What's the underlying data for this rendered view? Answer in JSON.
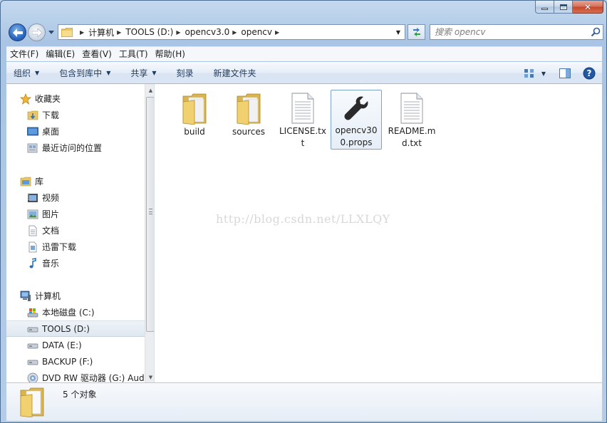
{
  "window": {
    "close_glyph": "✕"
  },
  "address": {
    "crumbs": [
      "计算机",
      "TOOLS (D:)",
      "opencv3.0",
      "opencv"
    ]
  },
  "search": {
    "placeholder": "搜索 opencv"
  },
  "menu": {
    "items": [
      "文件(F)",
      "编辑(E)",
      "查看(V)",
      "工具(T)",
      "帮助(H)"
    ]
  },
  "toolbar": {
    "organize": "组织",
    "include_library": "包含到库中",
    "share": "共享",
    "burn": "刻录",
    "new_folder": "新建文件夹"
  },
  "nav": {
    "favorites": {
      "label": "收藏夹",
      "items": [
        "下载",
        "桌面",
        "最近访问的位置"
      ]
    },
    "libraries": {
      "label": "库",
      "items": [
        "视频",
        "图片",
        "文档",
        "迅雷下载",
        "音乐"
      ]
    },
    "computer": {
      "label": "计算机",
      "items": [
        "本地磁盘 (C:)",
        "TOOLS (D:)",
        "DATA (E:)",
        "BACKUP (F:)",
        "DVD RW 驱动器 (G:) Aud"
      ]
    }
  },
  "files": [
    {
      "name": "build",
      "type": "folder"
    },
    {
      "name": "sources",
      "type": "folder"
    },
    {
      "name": "LICENSE.txt",
      "type": "text"
    },
    {
      "name": "opencv300.props",
      "type": "props",
      "selected": true
    },
    {
      "name": "README.md.txt",
      "type": "text"
    }
  ],
  "watermark": "http://blog.csdn.net/LLXLQY",
  "status": {
    "text": "5 个对象"
  },
  "colors": {
    "accent": "#2c69c2",
    "folder": "#e9c766",
    "selection_border": "#7da2ce"
  }
}
